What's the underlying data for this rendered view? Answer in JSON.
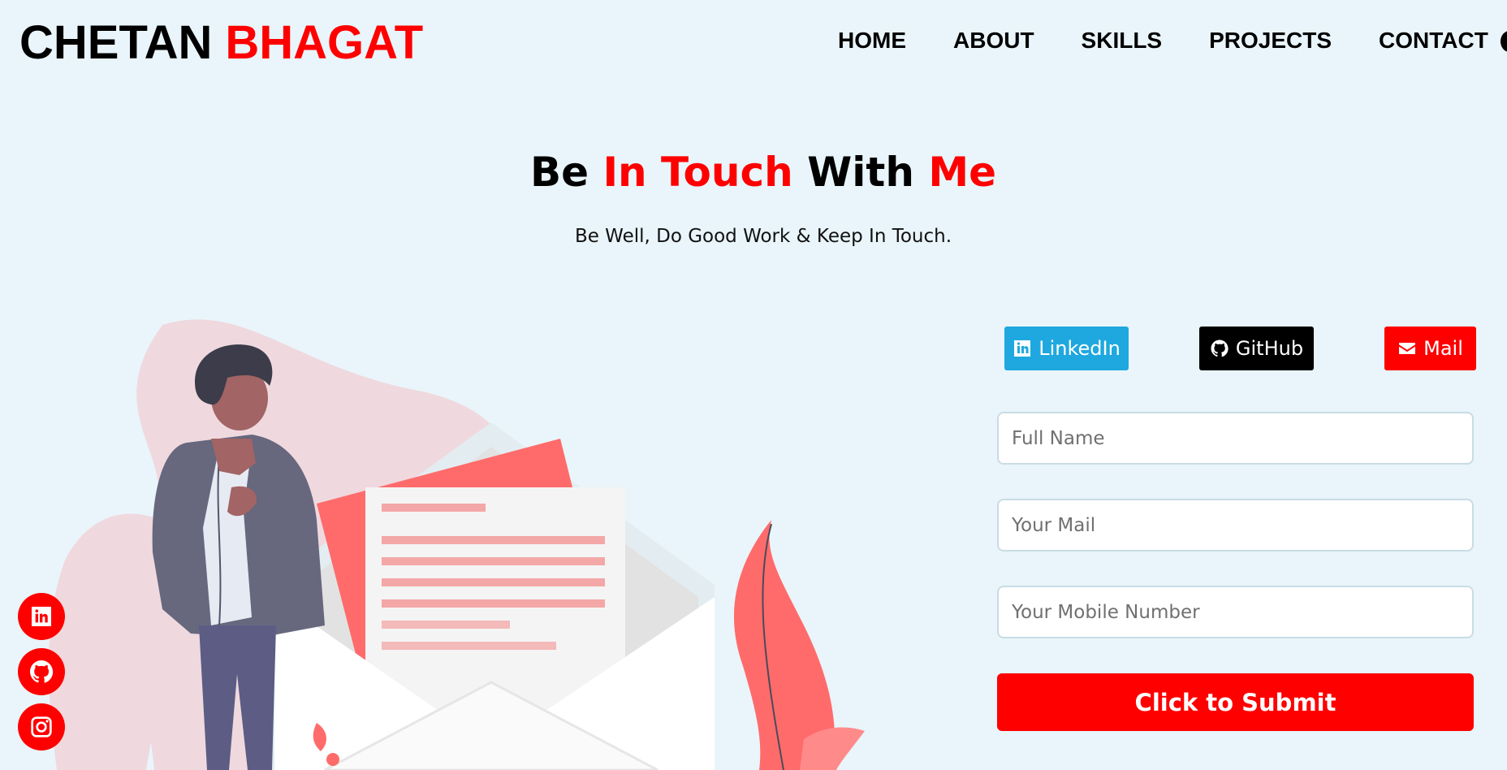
{
  "brand": {
    "first": "CHETAN",
    "last": "BHAGAT"
  },
  "nav": {
    "items": [
      {
        "label": "HOME"
      },
      {
        "label": "ABOUT"
      },
      {
        "label": "SKILLS"
      },
      {
        "label": "PROJECTS"
      },
      {
        "label": "CONTACT"
      }
    ]
  },
  "hero": {
    "title_parts": [
      "Be",
      "In Touch",
      "With",
      "Me"
    ],
    "subtitle": "Be Well, Do Good Work & Keep In Touch."
  },
  "social_buttons": {
    "linkedin": {
      "label": "LinkedIn",
      "icon": "linkedin-icon",
      "color": "#1ea8df"
    },
    "github": {
      "label": "GitHub",
      "icon": "github-icon",
      "color": "#000000"
    },
    "mail": {
      "label": "Mail",
      "icon": "envelope-icon",
      "color": "#ff0000"
    }
  },
  "form": {
    "full_name": {
      "placeholder": "Full Name",
      "value": ""
    },
    "email": {
      "placeholder": "Your Mail",
      "value": ""
    },
    "mobile": {
      "placeholder": "Your Mobile Number",
      "value": ""
    },
    "submit_label": "Click to Submit"
  },
  "sidebar_icons": [
    "linkedin-icon",
    "github-icon",
    "instagram-icon"
  ],
  "colors": {
    "accent": "#ff0000",
    "background": "#e9f5fa"
  }
}
